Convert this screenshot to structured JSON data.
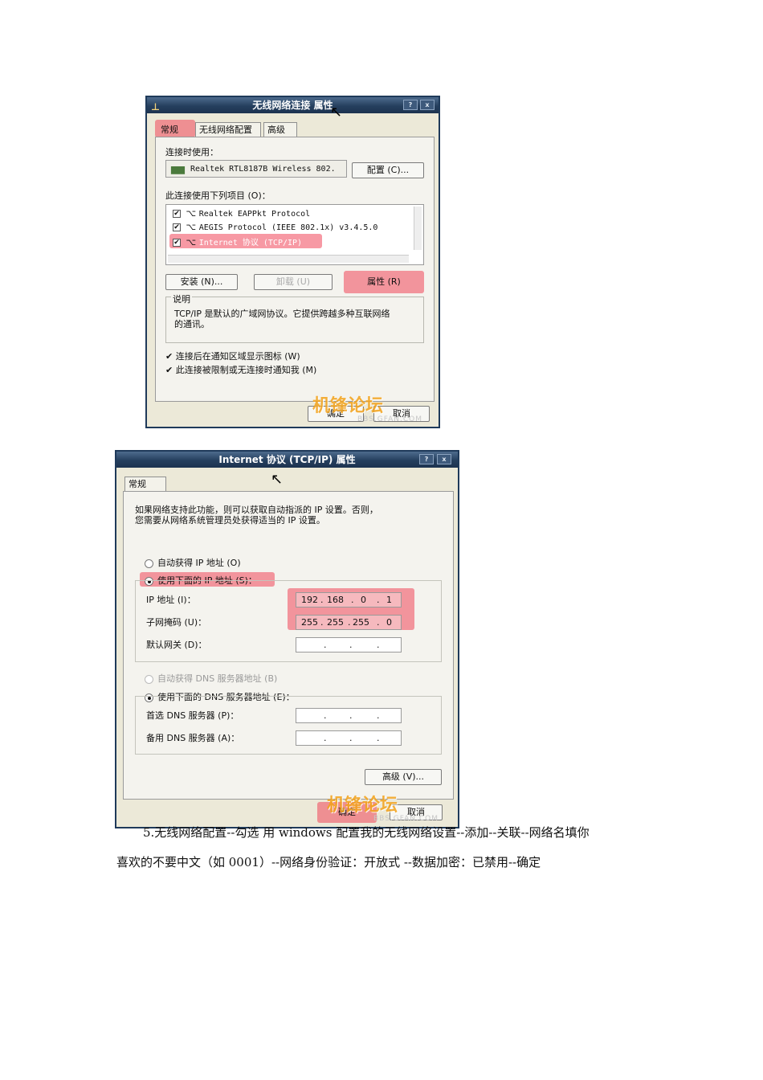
{
  "dialog1": {
    "title": "无线网络连接 属性",
    "help_btn": "?",
    "close_btn": "x",
    "tabs": [
      "常规",
      "无线网络配置",
      "高级"
    ],
    "connect_using_label": "连接时使用：",
    "adapter_name": "Realtek RTL8187B Wireless 802.",
    "configure_button": "配置 (C)...",
    "items_label": "此连接使用下列项目 (O)：",
    "items": [
      "Realtek EAPPkt Protocol",
      "AEGIS Protocol (IEEE 802.1x) v3.4.5.0",
      "Internet 协议 (TCP/IP)"
    ],
    "install_button": "安装 (N)...",
    "uninstall_button": "卸载 (U)",
    "properties_button": "属性 (R)",
    "description_title": "说明",
    "description_text_1": "TCP/IP 是默认的广域网协议。它提供跨越多种互联网络",
    "description_text_2": "的通讯。",
    "show_icon_check": "连接后在通知区域显示图标 (W)",
    "notify_check": "此连接被限制或无连接时通知我 (M)",
    "ok_button": "确定",
    "cancel_button": "取消",
    "watermark": "机锋论坛",
    "watermark_sub": "BBS.GFAN.COM"
  },
  "dialog2": {
    "title": "Internet 协议 (TCP/IP) 属性",
    "help_btn": "?",
    "close_btn": "x",
    "tab": "常规",
    "intro_1": "如果网络支持此功能，则可以获取自动指派的 IP 设置。否则，",
    "intro_2": "您需要从网络系统管理员处获得适当的 IP 设置。",
    "auto_ip": "自动获得 IP 地址 (O)",
    "manual_ip": "使用下面的 IP 地址 (S)：",
    "ip_label": "IP 地址 (I)：",
    "ip_value": [
      "192",
      "168",
      "0",
      "1"
    ],
    "mask_label": "子网掩码 (U)：",
    "mask_value": [
      "255",
      "255",
      "255",
      "0"
    ],
    "gateway_label": "默认网关 (D)：",
    "auto_dns": "自动获得 DNS 服务器地址 (B)",
    "manual_dns": "使用下面的 DNS 服务器地址 (E)：",
    "pref_dns_label": "首选 DNS 服务器 (P)：",
    "alt_dns_label": "备用 DNS 服务器 (A)：",
    "advanced_button": "高级 (V)...",
    "ok_button": "确定",
    "cancel_button": "取消",
    "watermark": "机锋论坛",
    "watermark_sub": "BBS.GFAN.COM"
  },
  "caption": {
    "line1": "5.无线网络配置--勾选 用 windows 配置我的无线网络设置--添加--关联--网络名填你",
    "line2": "喜欢的不要中文（如 0001）--网络身份验证：开放式 --数据加密：已禁用--确定"
  },
  "colors": {
    "highlight": "#f0465a",
    "titlebar": "#253f5e",
    "dialog_bg": "#ece9d8",
    "watermark": "#f3a21a"
  }
}
